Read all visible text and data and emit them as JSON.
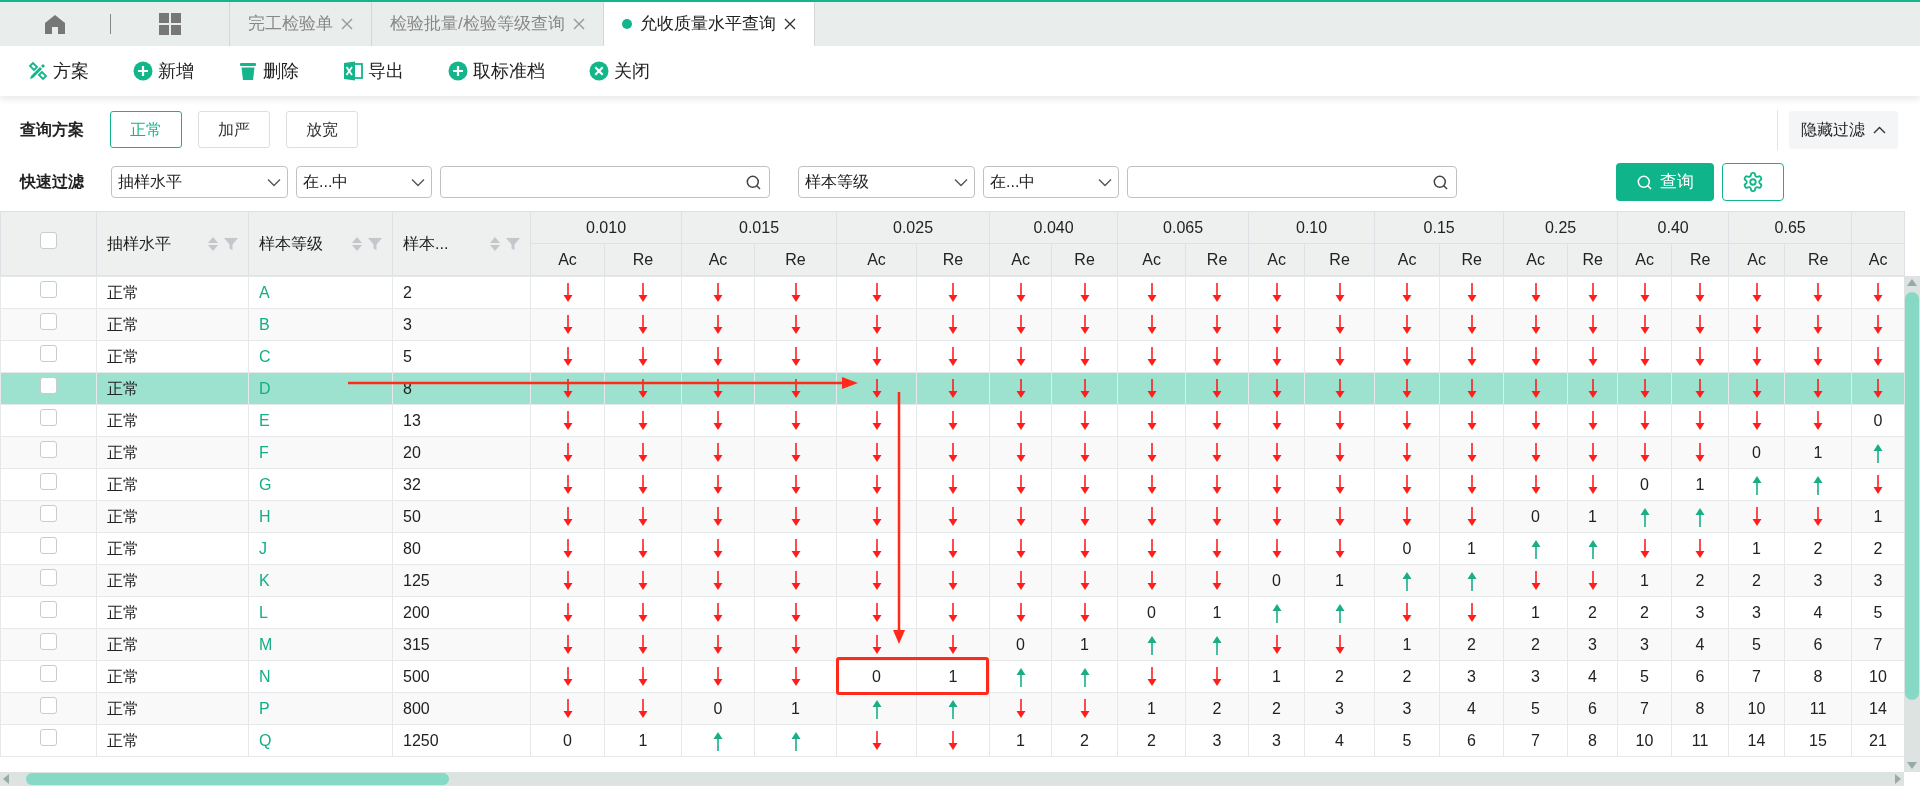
{
  "tab_bar": {
    "tabs": [
      {
        "label": "完工检验单",
        "selected": false
      },
      {
        "label": "检验批量/检验等级查询",
        "selected": false
      },
      {
        "label": "允收质量水平查询",
        "selected": true
      }
    ]
  },
  "toolbar": [
    {
      "label": "方案",
      "kind": "scheme"
    },
    {
      "label": "新增",
      "kind": "add"
    },
    {
      "label": "删除",
      "kind": "delete"
    },
    {
      "label": "导出",
      "kind": "export"
    },
    {
      "label": "取标准档",
      "kind": "add"
    },
    {
      "label": "关闭",
      "kind": "close"
    }
  ],
  "filter": {
    "scheme_label": "查询方案",
    "schemes": [
      {
        "label": "正常",
        "selected": true
      },
      {
        "label": "加严",
        "selected": false
      },
      {
        "label": "放宽",
        "selected": false
      }
    ],
    "toggle": "隐藏过滤",
    "quick_label": "快速过滤",
    "conditions": [
      {
        "field": "抽样水平",
        "operator": "在...中"
      },
      {
        "field": "样本等级",
        "operator": "在...中"
      }
    ],
    "search_button": "查询"
  },
  "table": {
    "select_all_checked": false,
    "columns": [
      {
        "label": "抽样水平"
      },
      {
        "label": "样本等级"
      },
      {
        "label": "样本..."
      }
    ],
    "groups": [
      {
        "label": "0.010",
        "subs": [
          "Ac",
          "Re"
        ]
      },
      {
        "label": "0.015",
        "subs": [
          "Ac",
          "Re"
        ]
      },
      {
        "label": "0.025",
        "subs": [
          "Ac",
          "Re"
        ]
      },
      {
        "label": "0.040",
        "subs": [
          "Ac",
          "Re"
        ]
      },
      {
        "label": "0.065",
        "subs": [
          "Ac",
          "Re"
        ]
      },
      {
        "label": "0.10",
        "subs": [
          "Ac",
          "Re"
        ]
      },
      {
        "label": "0.15",
        "subs": [
          "Ac",
          "Re"
        ]
      },
      {
        "label": "0.25",
        "subs": [
          "Ac",
          "Re"
        ]
      },
      {
        "label": "0.40",
        "subs": [
          "Ac",
          "Re"
        ]
      },
      {
        "label": "0.65",
        "subs": [
          "Ac",
          "Re"
        ]
      },
      {
        "subs": [
          "Ac"
        ]
      }
    ],
    "rows": [
      {
        "sampling_level": "正常",
        "grade": "A",
        "size": "2",
        "selected": false,
        "checked": false,
        "cells": [
          {
            "kind": "down"
          },
          {
            "kind": "down"
          },
          {
            "kind": "down"
          },
          {
            "kind": "down"
          },
          {
            "kind": "down"
          },
          {
            "kind": "down"
          },
          {
            "kind": "down"
          },
          {
            "kind": "down"
          },
          {
            "kind": "down"
          },
          {
            "kind": "down"
          },
          {
            "kind": "down"
          },
          {
            "kind": "down"
          },
          {
            "kind": "down"
          },
          {
            "kind": "down"
          },
          {
            "kind": "down"
          },
          {
            "kind": "down"
          },
          {
            "kind": "down"
          },
          {
            "kind": "down"
          },
          {
            "kind": "down"
          },
          {
            "kind": "down"
          },
          {
            "kind": "down"
          }
        ]
      },
      {
        "sampling_level": "正常",
        "grade": "B",
        "size": "3",
        "selected": false,
        "checked": false,
        "cells": [
          {
            "kind": "down"
          },
          {
            "kind": "down"
          },
          {
            "kind": "down"
          },
          {
            "kind": "down"
          },
          {
            "kind": "down"
          },
          {
            "kind": "down"
          },
          {
            "kind": "down"
          },
          {
            "kind": "down"
          },
          {
            "kind": "down"
          },
          {
            "kind": "down"
          },
          {
            "kind": "down"
          },
          {
            "kind": "down"
          },
          {
            "kind": "down"
          },
          {
            "kind": "down"
          },
          {
            "kind": "down"
          },
          {
            "kind": "down"
          },
          {
            "kind": "down"
          },
          {
            "kind": "down"
          },
          {
            "kind": "down"
          },
          {
            "kind": "down"
          },
          {
            "kind": "down"
          }
        ]
      },
      {
        "sampling_level": "正常",
        "grade": "C",
        "size": "5",
        "selected": false,
        "checked": false,
        "cells": [
          {
            "kind": "down"
          },
          {
            "kind": "down"
          },
          {
            "kind": "down"
          },
          {
            "kind": "down"
          },
          {
            "kind": "down"
          },
          {
            "kind": "down"
          },
          {
            "kind": "down"
          },
          {
            "kind": "down"
          },
          {
            "kind": "down"
          },
          {
            "kind": "down"
          },
          {
            "kind": "down"
          },
          {
            "kind": "down"
          },
          {
            "kind": "down"
          },
          {
            "kind": "down"
          },
          {
            "kind": "down"
          },
          {
            "kind": "down"
          },
          {
            "kind": "down"
          },
          {
            "kind": "down"
          },
          {
            "kind": "down"
          },
          {
            "kind": "down"
          },
          {
            "kind": "down"
          }
        ]
      },
      {
        "sampling_level": "正常",
        "grade": "D",
        "size": "8",
        "selected": true,
        "checked": false,
        "pointer": true,
        "cells": [
          {
            "kind": "down"
          },
          {
            "kind": "down"
          },
          {
            "kind": "down"
          },
          {
            "kind": "down"
          },
          {
            "kind": "down"
          },
          {
            "kind": "down"
          },
          {
            "kind": "down"
          },
          {
            "kind": "down"
          },
          {
            "kind": "down"
          },
          {
            "kind": "down"
          },
          {
            "kind": "down"
          },
          {
            "kind": "down"
          },
          {
            "kind": "down"
          },
          {
            "kind": "down"
          },
          {
            "kind": "down"
          },
          {
            "kind": "down"
          },
          {
            "kind": "down"
          },
          {
            "kind": "down"
          },
          {
            "kind": "down"
          },
          {
            "kind": "down"
          },
          {
            "kind": "down"
          }
        ]
      },
      {
        "sampling_level": "正常",
        "grade": "E",
        "size": "13",
        "selected": false,
        "checked": false,
        "cells": [
          {
            "kind": "down"
          },
          {
            "kind": "down"
          },
          {
            "kind": "down"
          },
          {
            "kind": "down"
          },
          {
            "kind": "down"
          },
          {
            "kind": "down"
          },
          {
            "kind": "down"
          },
          {
            "kind": "down"
          },
          {
            "kind": "down"
          },
          {
            "kind": "down"
          },
          {
            "kind": "down"
          },
          {
            "kind": "down"
          },
          {
            "kind": "down"
          },
          {
            "kind": "down"
          },
          {
            "kind": "down"
          },
          {
            "kind": "down"
          },
          {
            "kind": "down"
          },
          {
            "kind": "down"
          },
          {
            "kind": "down"
          },
          {
            "kind": "down"
          },
          {
            "kind": "value",
            "text": "0"
          }
        ]
      },
      {
        "sampling_level": "正常",
        "grade": "F",
        "size": "20",
        "selected": false,
        "checked": false,
        "cells": [
          {
            "kind": "down"
          },
          {
            "kind": "down"
          },
          {
            "kind": "down"
          },
          {
            "kind": "down"
          },
          {
            "kind": "down"
          },
          {
            "kind": "down"
          },
          {
            "kind": "down"
          },
          {
            "kind": "down"
          },
          {
            "kind": "down"
          },
          {
            "kind": "down"
          },
          {
            "kind": "down"
          },
          {
            "kind": "down"
          },
          {
            "kind": "down"
          },
          {
            "kind": "down"
          },
          {
            "kind": "down"
          },
          {
            "kind": "down"
          },
          {
            "kind": "down"
          },
          {
            "kind": "down"
          },
          {
            "kind": "value",
            "text": "0"
          },
          {
            "kind": "value",
            "text": "1"
          },
          {
            "kind": "up"
          }
        ]
      },
      {
        "sampling_level": "正常",
        "grade": "G",
        "size": "32",
        "selected": false,
        "checked": false,
        "cells": [
          {
            "kind": "down"
          },
          {
            "kind": "down"
          },
          {
            "kind": "down"
          },
          {
            "kind": "down"
          },
          {
            "kind": "down"
          },
          {
            "kind": "down"
          },
          {
            "kind": "down"
          },
          {
            "kind": "down"
          },
          {
            "kind": "down"
          },
          {
            "kind": "down"
          },
          {
            "kind": "down"
          },
          {
            "kind": "down"
          },
          {
            "kind": "down"
          },
          {
            "kind": "down"
          },
          {
            "kind": "down"
          },
          {
            "kind": "down"
          },
          {
            "kind": "value",
            "text": "0"
          },
          {
            "kind": "value",
            "text": "1"
          },
          {
            "kind": "up"
          },
          {
            "kind": "up"
          },
          {
            "kind": "down"
          }
        ]
      },
      {
        "sampling_level": "正常",
        "grade": "H",
        "size": "50",
        "selected": false,
        "checked": false,
        "cells": [
          {
            "kind": "down"
          },
          {
            "kind": "down"
          },
          {
            "kind": "down"
          },
          {
            "kind": "down"
          },
          {
            "kind": "down"
          },
          {
            "kind": "down"
          },
          {
            "kind": "down"
          },
          {
            "kind": "down"
          },
          {
            "kind": "down"
          },
          {
            "kind": "down"
          },
          {
            "kind": "down"
          },
          {
            "kind": "down"
          },
          {
            "kind": "down"
          },
          {
            "kind": "down"
          },
          {
            "kind": "value",
            "text": "0"
          },
          {
            "kind": "value",
            "text": "1"
          },
          {
            "kind": "up"
          },
          {
            "kind": "up"
          },
          {
            "kind": "down"
          },
          {
            "kind": "down"
          },
          {
            "kind": "value",
            "text": "1"
          }
        ]
      },
      {
        "sampling_level": "正常",
        "grade": "J",
        "size": "80",
        "selected": false,
        "checked": false,
        "cells": [
          {
            "kind": "down"
          },
          {
            "kind": "down"
          },
          {
            "kind": "down"
          },
          {
            "kind": "down"
          },
          {
            "kind": "down"
          },
          {
            "kind": "down"
          },
          {
            "kind": "down"
          },
          {
            "kind": "down"
          },
          {
            "kind": "down"
          },
          {
            "kind": "down"
          },
          {
            "kind": "down"
          },
          {
            "kind": "down"
          },
          {
            "kind": "value",
            "text": "0"
          },
          {
            "kind": "value",
            "text": "1"
          },
          {
            "kind": "up"
          },
          {
            "kind": "up"
          },
          {
            "kind": "down"
          },
          {
            "kind": "down"
          },
          {
            "kind": "value",
            "text": "1"
          },
          {
            "kind": "value",
            "text": "2"
          },
          {
            "kind": "value",
            "text": "2"
          }
        ]
      },
      {
        "sampling_level": "正常",
        "grade": "K",
        "size": "125",
        "selected": false,
        "checked": false,
        "cells": [
          {
            "kind": "down"
          },
          {
            "kind": "down"
          },
          {
            "kind": "down"
          },
          {
            "kind": "down"
          },
          {
            "kind": "down"
          },
          {
            "kind": "down"
          },
          {
            "kind": "down"
          },
          {
            "kind": "down"
          },
          {
            "kind": "down"
          },
          {
            "kind": "down"
          },
          {
            "kind": "value",
            "text": "0"
          },
          {
            "kind": "value",
            "text": "1"
          },
          {
            "kind": "up"
          },
          {
            "kind": "up"
          },
          {
            "kind": "down"
          },
          {
            "kind": "down"
          },
          {
            "kind": "value",
            "text": "1"
          },
          {
            "kind": "value",
            "text": "2"
          },
          {
            "kind": "value",
            "text": "2"
          },
          {
            "kind": "value",
            "text": "3"
          },
          {
            "kind": "value",
            "text": "3"
          }
        ]
      },
      {
        "sampling_level": "正常",
        "grade": "L",
        "size": "200",
        "selected": false,
        "checked": false,
        "cells": [
          {
            "kind": "down"
          },
          {
            "kind": "down"
          },
          {
            "kind": "down"
          },
          {
            "kind": "down"
          },
          {
            "kind": "down"
          },
          {
            "kind": "down"
          },
          {
            "kind": "down"
          },
          {
            "kind": "down"
          },
          {
            "kind": "value",
            "text": "0"
          },
          {
            "kind": "value",
            "text": "1"
          },
          {
            "kind": "up"
          },
          {
            "kind": "up"
          },
          {
            "kind": "down"
          },
          {
            "kind": "down"
          },
          {
            "kind": "value",
            "text": "1"
          },
          {
            "kind": "value",
            "text": "2"
          },
          {
            "kind": "value",
            "text": "2"
          },
          {
            "kind": "value",
            "text": "3"
          },
          {
            "kind": "value",
            "text": "3"
          },
          {
            "kind": "value",
            "text": "4"
          },
          {
            "kind": "value",
            "text": "5"
          }
        ]
      },
      {
        "sampling_level": "正常",
        "grade": "M",
        "size": "315",
        "selected": false,
        "checked": false,
        "cells": [
          {
            "kind": "down"
          },
          {
            "kind": "down"
          },
          {
            "kind": "down"
          },
          {
            "kind": "down"
          },
          {
            "kind": "down"
          },
          {
            "kind": "down"
          },
          {
            "kind": "value",
            "text": "0"
          },
          {
            "kind": "value",
            "text": "1"
          },
          {
            "kind": "up"
          },
          {
            "kind": "up"
          },
          {
            "kind": "down"
          },
          {
            "kind": "down"
          },
          {
            "kind": "value",
            "text": "1"
          },
          {
            "kind": "value",
            "text": "2"
          },
          {
            "kind": "value",
            "text": "2"
          },
          {
            "kind": "value",
            "text": "3"
          },
          {
            "kind": "value",
            "text": "3"
          },
          {
            "kind": "value",
            "text": "4"
          },
          {
            "kind": "value",
            "text": "5"
          },
          {
            "kind": "value",
            "text": "6"
          },
          {
            "kind": "value",
            "text": "7"
          }
        ]
      },
      {
        "sampling_level": "正常",
        "grade": "N",
        "size": "500",
        "selected": false,
        "checked": false,
        "cells": [
          {
            "kind": "down"
          },
          {
            "kind": "down"
          },
          {
            "kind": "down"
          },
          {
            "kind": "down"
          },
          {
            "kind": "value",
            "text": "0",
            "framed": true
          },
          {
            "kind": "value",
            "text": "1",
            "framed": true
          },
          {
            "kind": "up"
          },
          {
            "kind": "up"
          },
          {
            "kind": "down"
          },
          {
            "kind": "down"
          },
          {
            "kind": "value",
            "text": "1"
          },
          {
            "kind": "value",
            "text": "2"
          },
          {
            "kind": "value",
            "text": "2"
          },
          {
            "kind": "value",
            "text": "3"
          },
          {
            "kind": "value",
            "text": "3"
          },
          {
            "kind": "value",
            "text": "4"
          },
          {
            "kind": "value",
            "text": "5"
          },
          {
            "kind": "value",
            "text": "6"
          },
          {
            "kind": "value",
            "text": "7"
          },
          {
            "kind": "value",
            "text": "8"
          },
          {
            "kind": "value",
            "text": "10"
          }
        ]
      },
      {
        "sampling_level": "正常",
        "grade": "P",
        "size": "800",
        "selected": false,
        "checked": false,
        "cells": [
          {
            "kind": "down"
          },
          {
            "kind": "down"
          },
          {
            "kind": "value",
            "text": "0"
          },
          {
            "kind": "value",
            "text": "1"
          },
          {
            "kind": "up"
          },
          {
            "kind": "up"
          },
          {
            "kind": "down"
          },
          {
            "kind": "down"
          },
          {
            "kind": "value",
            "text": "1"
          },
          {
            "kind": "value",
            "text": "2"
          },
          {
            "kind": "value",
            "text": "2"
          },
          {
            "kind": "value",
            "text": "3"
          },
          {
            "kind": "value",
            "text": "3"
          },
          {
            "kind": "value",
            "text": "4"
          },
          {
            "kind": "value",
            "text": "5"
          },
          {
            "kind": "value",
            "text": "6"
          },
          {
            "kind": "value",
            "text": "7"
          },
          {
            "kind": "value",
            "text": "8"
          },
          {
            "kind": "value",
            "text": "10"
          },
          {
            "kind": "value",
            "text": "11"
          },
          {
            "kind": "value",
            "text": "14"
          }
        ]
      },
      {
        "sampling_level": "正常",
        "grade": "Q",
        "size": "1250",
        "selected": false,
        "checked": false,
        "cells": [
          {
            "kind": "value",
            "text": "0"
          },
          {
            "kind": "value",
            "text": "1"
          },
          {
            "kind": "up"
          },
          {
            "kind": "up"
          },
          {
            "kind": "down"
          },
          {
            "kind": "down"
          },
          {
            "kind": "value",
            "text": "1"
          },
          {
            "kind": "value",
            "text": "2"
          },
          {
            "kind": "value",
            "text": "2"
          },
          {
            "kind": "value",
            "text": "3"
          },
          {
            "kind": "value",
            "text": "3"
          },
          {
            "kind": "value",
            "text": "4"
          },
          {
            "kind": "value",
            "text": "5"
          },
          {
            "kind": "value",
            "text": "6"
          },
          {
            "kind": "value",
            "text": "7"
          },
          {
            "kind": "value",
            "text": "8"
          },
          {
            "kind": "value",
            "text": "10"
          },
          {
            "kind": "value",
            "text": "11"
          },
          {
            "kind": "value",
            "text": "14"
          },
          {
            "kind": "value",
            "text": "15"
          },
          {
            "kind": "value",
            "text": "21"
          }
        ]
      }
    ]
  }
}
